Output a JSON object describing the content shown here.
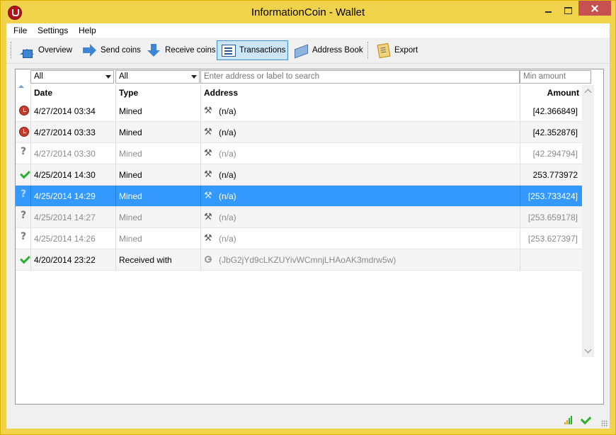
{
  "window": {
    "title": "InformationCoin - Wallet"
  },
  "menu": [
    "File",
    "Settings",
    "Help"
  ],
  "toolbar": {
    "overview": "Overview",
    "send": "Send coins",
    "receive": "Receive coins",
    "transactions": "Transactions",
    "address_book": "Address Book",
    "export": "Export"
  },
  "filters": {
    "date": "All",
    "type": "All",
    "search_placeholder": "Enter address or label to search",
    "min_amount_placeholder": "Min amount"
  },
  "table": {
    "headers": {
      "date": "Date",
      "type": "Type",
      "address": "Address",
      "amount": "Amount"
    },
    "rows": [
      {
        "status": "clock",
        "date": "4/27/2014 03:34",
        "type": "Mined",
        "address": "(n/a)",
        "amount": "[42.366849]"
      },
      {
        "status": "clock",
        "date": "4/27/2014 03:33",
        "type": "Mined",
        "address": "(n/a)",
        "amount": "[42.352876]"
      },
      {
        "status": "unknown",
        "date": "4/27/2014 03:30",
        "type": "Mined",
        "address": "(n/a)",
        "amount": "[42.294794]"
      },
      {
        "status": "confirmed",
        "date": "4/25/2014 14:30",
        "type": "Mined",
        "address": "(n/a)",
        "amount": "253.773972"
      },
      {
        "status": "unknown",
        "date": "4/25/2014 14:29",
        "type": "Mined",
        "address": "(n/a)",
        "amount": "[253.733424]"
      },
      {
        "status": "unknown",
        "date": "4/25/2014 14:27",
        "type": "Mined",
        "address": "(n/a)",
        "amount": "[253.659178]"
      },
      {
        "status": "unknown",
        "date": "4/25/2014 14:26",
        "type": "Mined",
        "address": "(n/a)",
        "amount": "[253.627397]"
      },
      {
        "status": "confirmed",
        "date": "4/20/2014 23:22",
        "type": "Received with",
        "address": "(JbG2jYd9cLKZUYivWCmnjLHAoAK3mdrw5w)",
        "amount": ""
      }
    ]
  },
  "colors": {
    "selection": "#3399ff",
    "titlebar": "#f0d34a",
    "close": "#c75050"
  }
}
